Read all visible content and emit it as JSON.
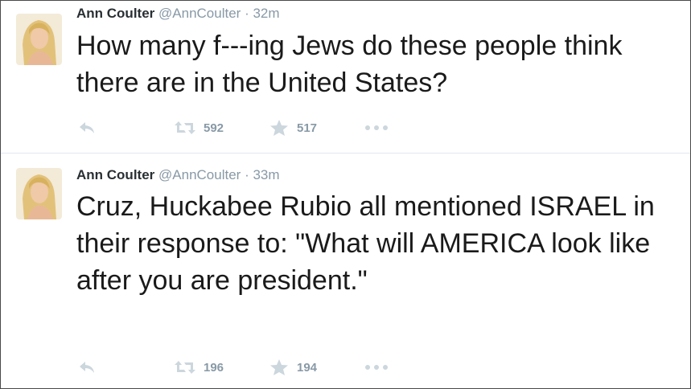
{
  "tweets": [
    {
      "author": {
        "name": "Ann Coulter",
        "handle": "@AnnCoulter"
      },
      "separator": "·",
      "time": "32m",
      "text": "How many f---ing Jews do these people think there are in the United States?",
      "retweets": "592",
      "favorites": "517"
    },
    {
      "author": {
        "name": "Ann Coulter",
        "handle": "@AnnCoulter"
      },
      "separator": "·",
      "time": "33m",
      "text": "Cruz, Huckabee Rubio all mentioned ISRAEL in their response to: \"What will AMERICA look like after you are president.\"",
      "retweets": "196",
      "favorites": "194"
    }
  ],
  "icons": {
    "reply": "reply-icon",
    "retweet": "retweet-icon",
    "favorite": "star-icon",
    "more": "more-dots-icon"
  },
  "colors": {
    "text": "#292f33",
    "muted": "#8899a6",
    "icon": "#ccd6dd",
    "divider": "#e1e8ed",
    "frame": "#4a4a4a"
  }
}
